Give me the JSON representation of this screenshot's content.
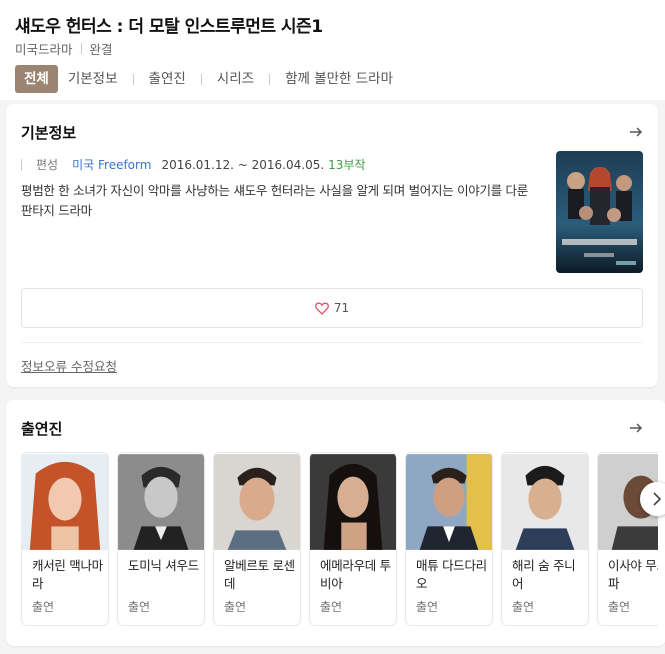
{
  "header": {
    "title": "섀도우 헌터스 : 더 모탈 인스트루먼트 시즌1",
    "genre": "미국드라마",
    "status": "완결",
    "tabs": [
      {
        "label": "전체",
        "active": true
      },
      {
        "label": "기본정보",
        "active": false
      },
      {
        "label": "출연진",
        "active": false
      },
      {
        "label": "시리즈",
        "active": false
      },
      {
        "label": "함께 볼만한 드라마",
        "active": false
      }
    ]
  },
  "basic_info": {
    "title": "기본정보",
    "arrow_icon": "arrow-right-icon",
    "meta_label": "편성",
    "network": "미국 Freeform",
    "date_range": "2016.01.12. ~ 2016.04.05.",
    "episodes": "13부작",
    "description": "평범한 한 소녀가 자신이 악마를 사냥하는 섀도우 헌터라는 사실을 알게 되며 벌어지는 이야기를 다룬 판타지 드라마",
    "poster_icon": "poster-image",
    "likes": "71",
    "like_icon": "heart-icon",
    "error_report": "정보오류 수정요청"
  },
  "cast": {
    "title": "출연진",
    "arrow_icon": "arrow-right-icon",
    "members": [
      {
        "name": "캐서린 맥나마라",
        "role": "출연"
      },
      {
        "name": "도미닉 셔우드",
        "role": "출연"
      },
      {
        "name": "알베르토 로센데",
        "role": "출연"
      },
      {
        "name": "에메라우데 투비아",
        "role": "출연"
      },
      {
        "name": "매튜 다드다리오",
        "role": "출연"
      },
      {
        "name": "해리 숨 주니어",
        "role": "출연"
      },
      {
        "name": "이사야 무스타파",
        "role": "출연"
      }
    ],
    "next_icon": "chevron-right-icon"
  },
  "colors": {
    "active_tab": "#9b8472",
    "link": "#3b75c5",
    "episodes": "#3f9a3f",
    "heart": "#e0556a"
  }
}
